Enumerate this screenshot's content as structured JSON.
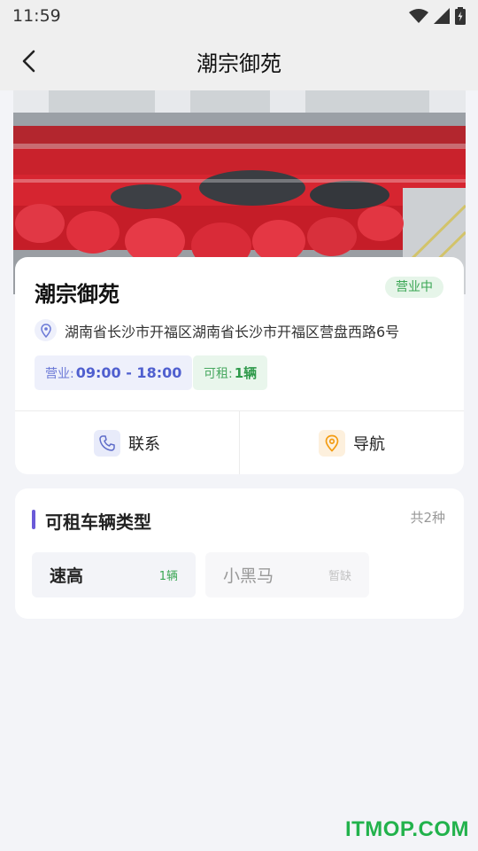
{
  "status_bar": {
    "time": "11:59"
  },
  "header": {
    "title": "潮宗御苑"
  },
  "store": {
    "name": "潮宗御苑",
    "status": "营业中",
    "address": "湖南省长沙市开福区湖南省长沙市开福区营盘西路6号",
    "hours_label": "营业:",
    "hours_value": "09:00 - 18:00",
    "rent_label": "可租:",
    "rent_value": "1辆"
  },
  "actions": {
    "contact": "联系",
    "navigate": "导航"
  },
  "vehicle_types": {
    "title": "可租车辆类型",
    "count": "共2种",
    "items": [
      {
        "name": "速高",
        "quantity": "1辆"
      },
      {
        "name": "小黑马",
        "quantity": "暂缺"
      }
    ]
  },
  "watermark": "ITMOP.COM",
  "colors": {
    "accent": "#6a5ad8",
    "green": "#3aa654",
    "orange": "#f39c12"
  }
}
